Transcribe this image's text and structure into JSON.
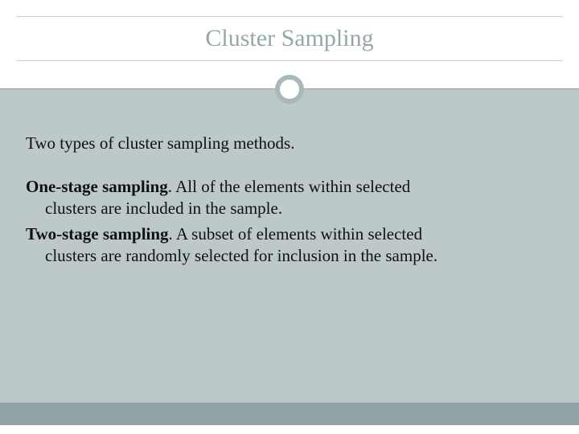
{
  "title": "Cluster Sampling",
  "intro": "Two types of cluster sampling methods.",
  "items": [
    {
      "heading": "One-stage sampling",
      "rest1": ". All of the elements within selected",
      "rest2": "clusters are included in the sample."
    },
    {
      "heading": "Two-stage sampling",
      "rest1": ". A subset of elements within selected",
      "rest2": "clusters are randomly selected for inclusion in the sample."
    }
  ]
}
